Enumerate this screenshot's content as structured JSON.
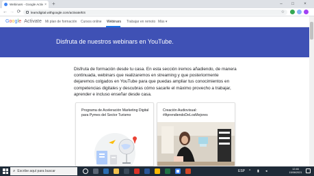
{
  "browser": {
    "tab_title": "Webinars - Google Activate",
    "tab_close": "×",
    "new_tab": "+",
    "url": "learndigital.withgoogle.com/activate/ES",
    "window_controls": {
      "minimize": "–",
      "maximize": "□",
      "close": "×"
    },
    "nav": {
      "back": "←",
      "forward": "→",
      "reload": "⟳"
    },
    "star": "☆"
  },
  "site": {
    "logo_google": [
      "G",
      "o",
      "o",
      "g",
      "l",
      "e"
    ],
    "logo_product": "Activate",
    "nav_items": [
      "Mi plan de formación",
      "Cursos online",
      "Webinars",
      "Trabajar en remoto",
      "Más ▾"
    ],
    "active_nav": "Webinars"
  },
  "banner": {
    "title": "Disfruta de nuestros webinars en YouTube."
  },
  "intro": "Disfruta de formación desde tu casa. En esta sección iremos añadiendo, de manera continuada, webinars que realizaremos en streaming y que posteriormente dejaremos colgados en YouTube para que puedas ampliar tus conocimientos en competencias digitales y descubras cómo sacarle el máximo provecho a trabajar, aprender e incluso enseñar desde casa.",
  "cards": [
    {
      "title": "Programa de Aceleración Marketing Digital para Pymes del Sector Turismo"
    },
    {
      "title": "Creación Audiovisual: #AprendiendoDeLosMejores"
    }
  ],
  "taskbar": {
    "search_placeholder": "Escribe aquí para buscar",
    "time": "12:46",
    "date": "15/06/2021",
    "lang": "ESP"
  },
  "colors": {
    "banner": "#3f51b5",
    "nav_underline": "#1a73e8",
    "taskbar": "#1f2b38"
  }
}
